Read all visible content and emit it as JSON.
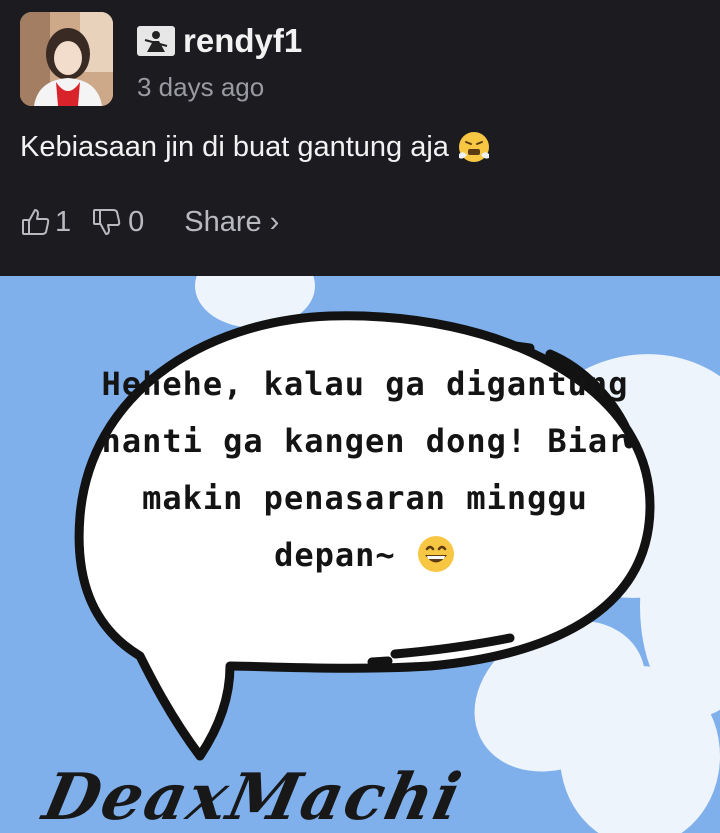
{
  "comment": {
    "username": "rendyf1",
    "time": "3 days ago",
    "text": "Kebiasaan jin di buat gantung aja",
    "likes": "1",
    "dislikes": "0",
    "share_label": "Share",
    "share_chevron": "›"
  },
  "panel": {
    "bubble_text": "Hehehe, kalau ga digantung nanti ga kangen dong! Biar makin penasaran minggu depan~",
    "signature": "DeaxMachi"
  }
}
